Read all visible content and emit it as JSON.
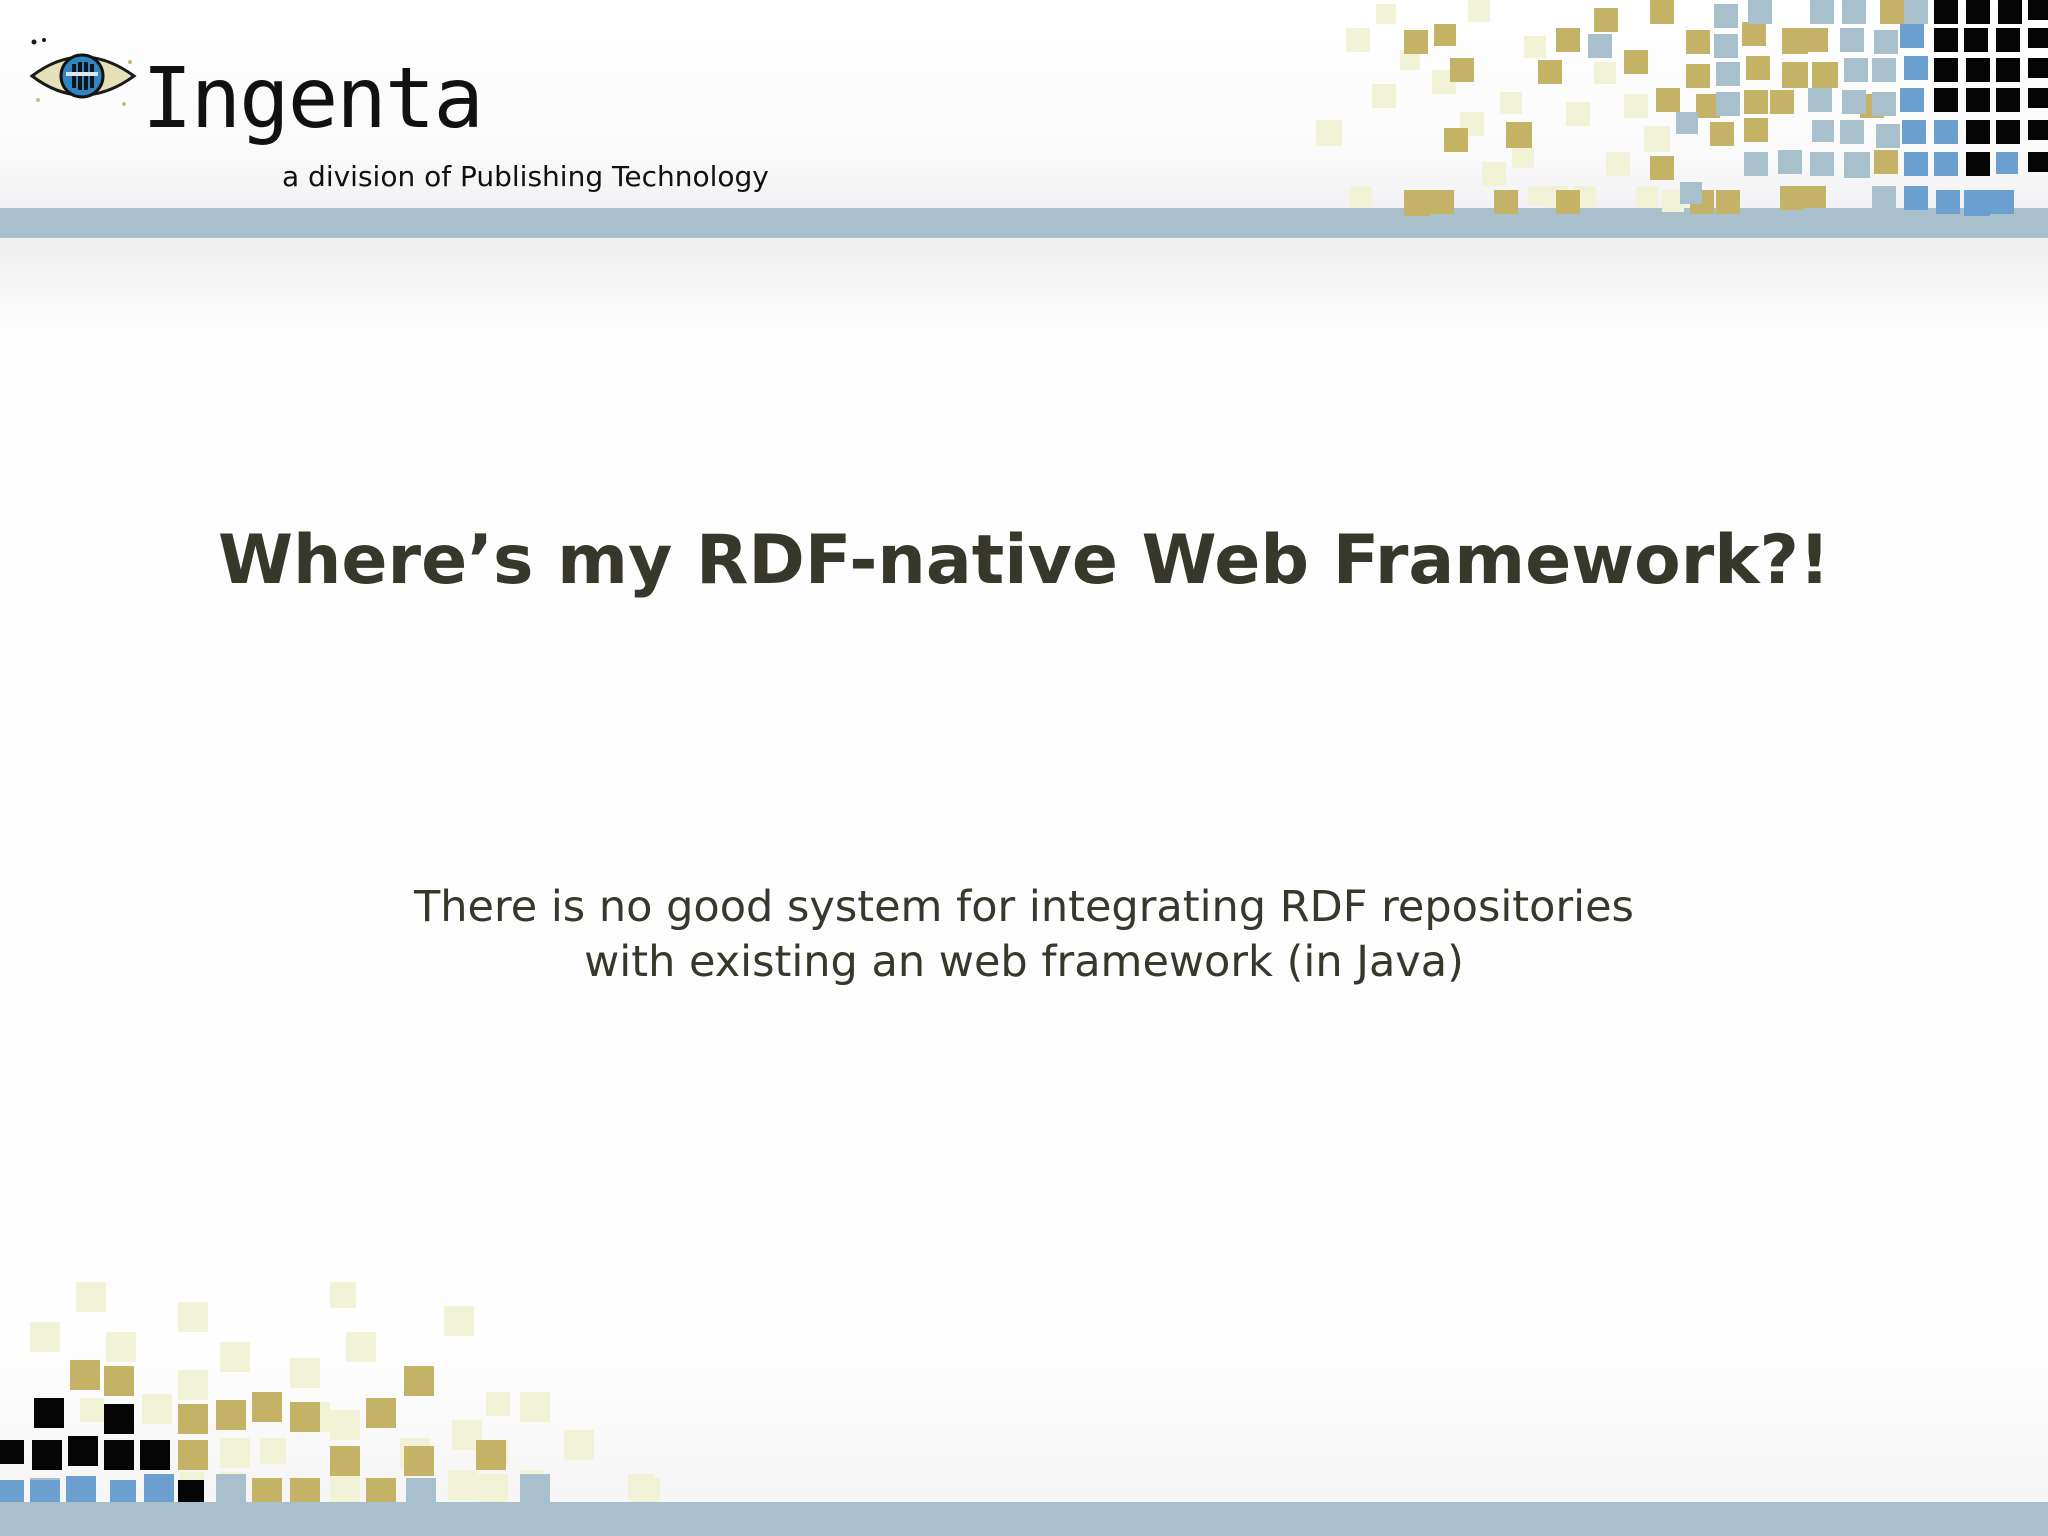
{
  "logo": {
    "wordmark": "Ingenta",
    "tagline": "a division of Publishing Technology",
    "icon": "eye-icon"
  },
  "slide": {
    "title": "Where’s my RDF-native Web Framework?!",
    "body_lines": [
      "There is no good system for integrating RDF repositories",
      "with existing an web framework (in Java)"
    ]
  },
  "colors": {
    "rule": "#a7c0cc",
    "text": "#37372b",
    "tile_pale": "#f2f3d6",
    "tile_gold": "#c4b267",
    "tile_blue_grey": "#a7c0cc",
    "tile_blue": "#6a9fd0",
    "tile_black": "#050505"
  }
}
